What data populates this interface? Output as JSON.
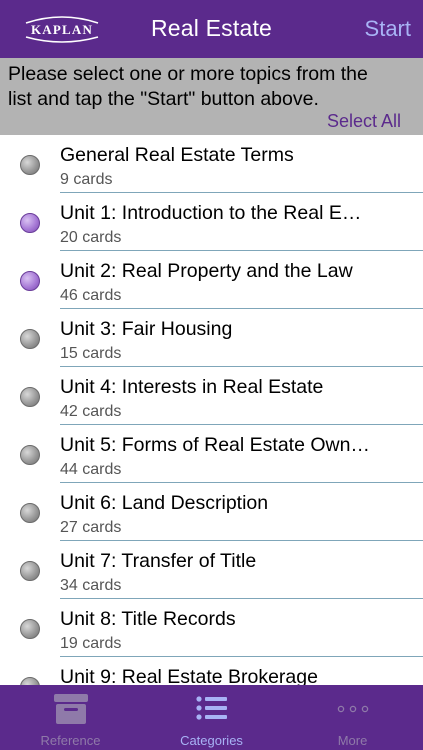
{
  "header": {
    "logo_text": "KAPLAN",
    "title": "Real Estate",
    "start_label": "Start"
  },
  "instructions": {
    "text": "Please select one or more topics from the list and tap the \"Start\" button above.",
    "select_all_label": "Select All"
  },
  "topics": [
    {
      "name": "General Real Estate Terms",
      "count": "9 cards",
      "selected": false
    },
    {
      "name": "Unit 1: Introduction to the Real E…",
      "count": "20 cards",
      "selected": true
    },
    {
      "name": "Unit 2: Real Property and the Law",
      "count": "46 cards",
      "selected": true
    },
    {
      "name": "Unit 3: Fair Housing",
      "count": "15 cards",
      "selected": false
    },
    {
      "name": "Unit 4: Interests in Real Estate",
      "count": "42 cards",
      "selected": false
    },
    {
      "name": "Unit 5: Forms of Real Estate Own…",
      "count": "44 cards",
      "selected": false
    },
    {
      "name": "Unit 6: Land Description",
      "count": "27 cards",
      "selected": false
    },
    {
      "name": "Unit 7: Transfer of Title",
      "count": "34 cards",
      "selected": false
    },
    {
      "name": "Unit 8: Title Records",
      "count": "19 cards",
      "selected": false
    },
    {
      "name": "Unit 9: Real Estate Brokerage",
      "count": "",
      "selected": false
    }
  ],
  "tabbar": {
    "tabs": [
      {
        "label": "Reference",
        "icon": "archive-box-icon",
        "active": false
      },
      {
        "label": "Categories",
        "icon": "list-icon",
        "active": true
      },
      {
        "label": "More",
        "icon": "more-dots-icon",
        "active": false
      }
    ]
  },
  "colors": {
    "brand_purple": "#5b2a8c",
    "accent_blue": "#a8b3f5",
    "instruction_bg": "#b3b3b3",
    "separator": "#7fa6b9"
  }
}
